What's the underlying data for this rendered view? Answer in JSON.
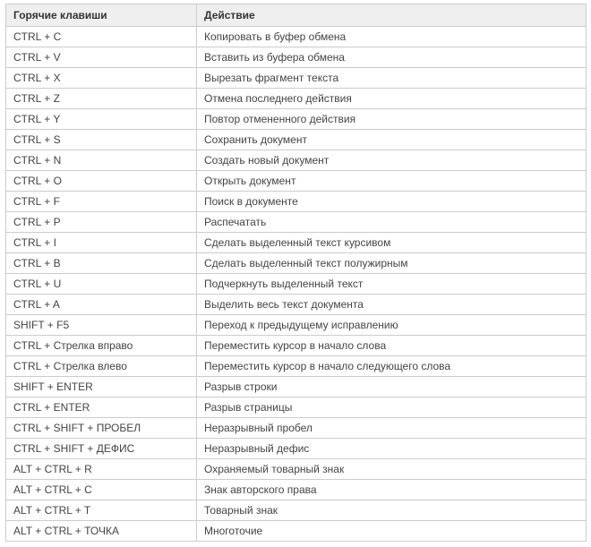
{
  "table": {
    "headers": {
      "hotkey": "Горячие клавиши",
      "action": "Действие"
    },
    "rows": [
      {
        "hotkey": "CTRL + C",
        "action": "Копировать в буфер обмена"
      },
      {
        "hotkey": "CTRL + V",
        "action": "Вставить из буфера обмена"
      },
      {
        "hotkey": "CTRL + X",
        "action": "Вырезать фрагмент текста"
      },
      {
        "hotkey": "CTRL + Z",
        "action": "Отмена последнего действия"
      },
      {
        "hotkey": "CTRL + Y",
        "action": "Повтор отмененного действия"
      },
      {
        "hotkey": "CTRL + S",
        "action": "Сохранить документ"
      },
      {
        "hotkey": "CTRL + N",
        "action": "Создать новый документ"
      },
      {
        "hotkey": "CTRL + O",
        "action": "Открыть документ"
      },
      {
        "hotkey": "CTRL + F",
        "action": "Поиск в документе"
      },
      {
        "hotkey": "CTRL + P",
        "action": "Распечатать"
      },
      {
        "hotkey": "CTRL + I",
        "action": "Сделать выделенный текст курсивом"
      },
      {
        "hotkey": "CTRL + B",
        "action": "Сделать выделенный текст полужирным"
      },
      {
        "hotkey": "CTRL + U",
        "action": "Подчеркнуть выделенный текст"
      },
      {
        "hotkey": "CTRL + A",
        "action": "Выделить весь текст документа"
      },
      {
        "hotkey": "SHIFT + F5",
        "action": "Переход к предыдущему исправлению"
      },
      {
        "hotkey": "CTRL + Стрелка вправо",
        "action": "Переместить курсор в начало слова"
      },
      {
        "hotkey": "CTRL + Стрелка влево",
        "action": "Переместить курсор в начало следующего слова"
      },
      {
        "hotkey": "SHIFT + ENTER",
        "action": "Разрыв строки"
      },
      {
        "hotkey": "CTRL + ENTER",
        "action": "Разрыв страницы"
      },
      {
        "hotkey": "CTRL + SHIFT + ПРОБЕЛ",
        "action": "Неразрывный пробел"
      },
      {
        "hotkey": "CTRL + SHIFT + ДЕФИС",
        "action": "Неразрывный дефис"
      },
      {
        "hotkey": "ALT + CTRL + R",
        "action": "Охраняемый товарный знак"
      },
      {
        "hotkey": "ALT + CTRL + C",
        "action": "Знак авторского права"
      },
      {
        "hotkey": "ALT + CTRL + T",
        "action": "Товарный знак"
      },
      {
        "hotkey": "ALT + CTRL + ТОЧКА",
        "action": "Многоточие"
      }
    ]
  }
}
